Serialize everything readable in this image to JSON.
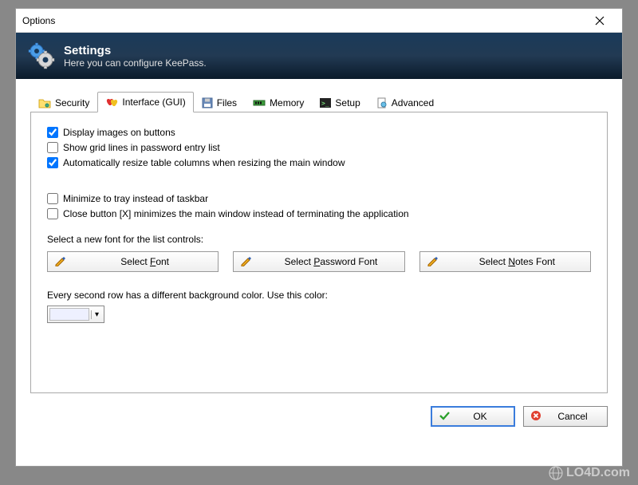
{
  "window": {
    "title": "Options"
  },
  "header": {
    "title": "Settings",
    "subtitle": "Here you can configure KeePass."
  },
  "tabs": [
    {
      "label": "Security"
    },
    {
      "label": "Interface (GUI)"
    },
    {
      "label": "Files"
    },
    {
      "label": "Memory"
    },
    {
      "label": "Setup"
    },
    {
      "label": "Advanced"
    }
  ],
  "checks": {
    "display_images": {
      "label": "Display images on buttons",
      "checked": true
    },
    "show_grid": {
      "label": "Show grid lines in password entry list",
      "checked": false
    },
    "auto_resize": {
      "label": "Automatically resize table columns when resizing the main window",
      "checked": true
    },
    "min_tray": {
      "label": "Minimize to tray instead of taskbar",
      "checked": false
    },
    "close_min": {
      "label": "Close button [X] minimizes the main window instead of terminating the application",
      "checked": false
    }
  },
  "font_section": {
    "label": "Select a new font for the list controls:",
    "buttons": {
      "font": "Select Font",
      "password": "Select Password Font",
      "notes": "Select Notes Font"
    }
  },
  "color_section": {
    "label": "Every second row has a different background color. Use this color:",
    "swatch": "#eef0ff"
  },
  "footer": {
    "ok": "OK",
    "cancel": "Cancel"
  },
  "watermark": "LO4D.com"
}
